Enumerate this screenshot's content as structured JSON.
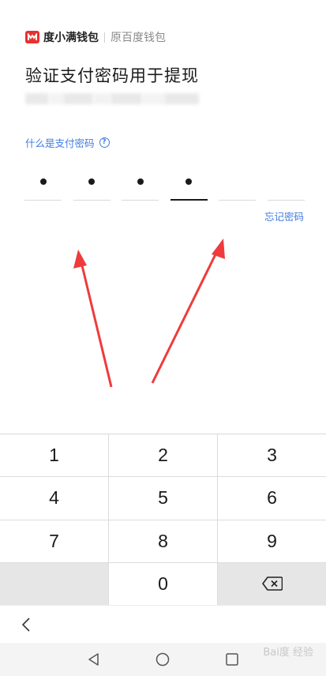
{
  "header": {
    "brand_name": "度小满钱包",
    "brand_sub": "原百度钱包"
  },
  "title": "验证支付密码用于提现",
  "help_link": "什么是支付密码",
  "help_icon": "question-circle-icon",
  "pin": {
    "length": 6,
    "filled": 4
  },
  "forgot_link": "忘记密码",
  "keyboard": {
    "rows": [
      [
        "1",
        "2",
        "3"
      ],
      [
        "4",
        "5",
        "6"
      ],
      [
        "7",
        "8",
        "9"
      ],
      [
        "",
        "0",
        "⌫"
      ]
    ]
  },
  "nav": {
    "back_icon": "chevron-left-icon"
  },
  "system_bar": {
    "icons": [
      "triangle-back-icon",
      "circle-home-icon",
      "square-recents-icon"
    ]
  },
  "watermark": "Bai度 经验",
  "colors": {
    "accent_blue": "#3f7be0",
    "brand_red": "#e8302f",
    "arrow_red": "#ef3b3b"
  }
}
